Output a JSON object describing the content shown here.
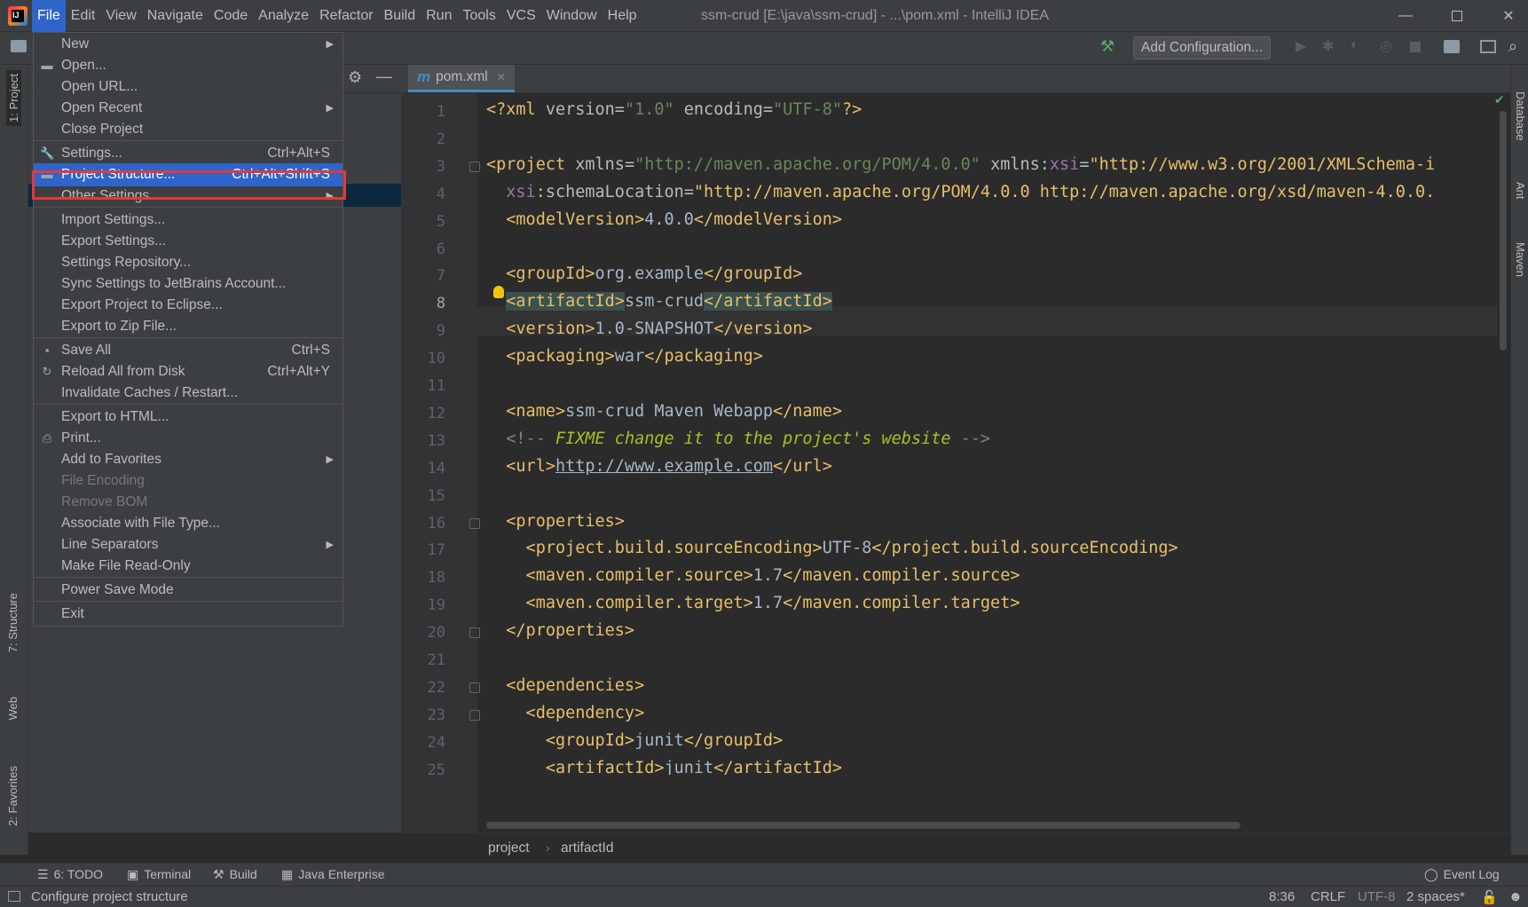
{
  "menubar": {
    "items": [
      "File",
      "Edit",
      "View",
      "Navigate",
      "Code",
      "Analyze",
      "Refactor",
      "Build",
      "Run",
      "Tools",
      "VCS",
      "Window",
      "Help"
    ],
    "window_title": "ssm-crud [E:\\java\\ssm-crud] - ...\\pom.xml - IntelliJ IDEA"
  },
  "toolbar": {
    "add_configuration": "Add Configuration..."
  },
  "editor_tab": {
    "label": "pom.xml"
  },
  "left_strip": {
    "project": "1: Project",
    "structure": "7: Structure",
    "web": "Web",
    "favorites": "2: Favorites"
  },
  "right_strip": {
    "database": "Database",
    "ant": "Ant",
    "maven": "Maven"
  },
  "file_menu": {
    "items": [
      {
        "label": "New",
        "shortcut": "",
        "submenu": true,
        "disabled": false
      },
      {
        "label": "Open...",
        "shortcut": "",
        "submenu": false,
        "disabled": false,
        "icon": "folder-icon"
      },
      {
        "label": "Open URL...",
        "shortcut": "",
        "submenu": false,
        "disabled": false
      },
      {
        "label": "Open Recent",
        "shortcut": "",
        "submenu": true,
        "disabled": false
      },
      {
        "label": "Close Project",
        "shortcut": "",
        "submenu": false,
        "disabled": false
      },
      {
        "label": "Settings...",
        "shortcut": "Ctrl+Alt+S",
        "submenu": false,
        "disabled": false,
        "icon": "wrench-icon"
      },
      {
        "label": "Project Structure...",
        "shortcut": "Ctrl+Alt+Shift+S",
        "submenu": false,
        "disabled": false,
        "selected": true,
        "icon": "project-structure-icon"
      },
      {
        "label": "Other Settings",
        "shortcut": "",
        "submenu": true,
        "disabled": false
      },
      {
        "label": "Import Settings...",
        "shortcut": "",
        "submenu": false,
        "disabled": false
      },
      {
        "label": "Export Settings...",
        "shortcut": "",
        "submenu": false,
        "disabled": false
      },
      {
        "label": "Settings Repository...",
        "shortcut": "",
        "submenu": false,
        "disabled": false
      },
      {
        "label": "Sync Settings to JetBrains Account...",
        "shortcut": "",
        "submenu": false,
        "disabled": false
      },
      {
        "label": "Export Project to Eclipse...",
        "shortcut": "",
        "submenu": false,
        "disabled": false
      },
      {
        "label": "Export to Zip File...",
        "shortcut": "",
        "submenu": false,
        "disabled": false
      },
      {
        "label": "Save All",
        "shortcut": "Ctrl+S",
        "submenu": false,
        "disabled": false,
        "icon": "save-icon"
      },
      {
        "label": "Reload All from Disk",
        "shortcut": "Ctrl+Alt+Y",
        "submenu": false,
        "disabled": false,
        "icon": "reload-icon"
      },
      {
        "label": "Invalidate Caches / Restart...",
        "shortcut": "",
        "submenu": false,
        "disabled": false
      },
      {
        "label": "Export to HTML...",
        "shortcut": "",
        "submenu": false,
        "disabled": false
      },
      {
        "label": "Print...",
        "shortcut": "",
        "submenu": false,
        "disabled": false,
        "icon": "print-icon"
      },
      {
        "label": "Add to Favorites",
        "shortcut": "",
        "submenu": true,
        "disabled": false
      },
      {
        "label": "File Encoding",
        "shortcut": "",
        "submenu": false,
        "disabled": true
      },
      {
        "label": "Remove BOM",
        "shortcut": "",
        "submenu": false,
        "disabled": true
      },
      {
        "label": "Associate with File Type...",
        "shortcut": "",
        "submenu": false,
        "disabled": false
      },
      {
        "label": "Line Separators",
        "shortcut": "",
        "submenu": true,
        "disabled": false
      },
      {
        "label": "Make File Read-Only",
        "shortcut": "",
        "submenu": false,
        "disabled": false
      },
      {
        "label": "Power Save Mode",
        "shortcut": "",
        "submenu": false,
        "disabled": false
      },
      {
        "label": "Exit",
        "shortcut": "",
        "submenu": false,
        "disabled": false
      }
    ]
  },
  "line_numbers": [
    "1",
    "2",
    "3",
    "4",
    "5",
    "6",
    "7",
    "8",
    "9",
    "10",
    "11",
    "12",
    "13",
    "14",
    "15",
    "16",
    "17",
    "18",
    "19",
    "20",
    "21",
    "22",
    "23",
    "24",
    "25"
  ],
  "code_lines": [
    "<?xml version=\"1.0\" encoding=\"UTF-8\"?>",
    "",
    "<project xmlns=\"http://maven.apache.org/POM/4.0.0\" xmlns:xsi=\"http://www.w3.org/2001/XMLSchema-i",
    "  xsi:schemaLocation=\"http://maven.apache.org/POM/4.0.0 http://maven.apache.org/xsd/maven-4.0.0.",
    "  <modelVersion>4.0.0</modelVersion>",
    "",
    "  <groupId>org.example</groupId>",
    "  <artifactId>ssm-crud</artifactId>",
    "  <version>1.0-SNAPSHOT</version>",
    "  <packaging>war</packaging>",
    "",
    "  <name>ssm-crud Maven Webapp</name>",
    "  <!-- FIXME change it to the project's website -->",
    "  <url>http://www.example.com</url>",
    "",
    "  <properties>",
    "    <project.build.sourceEncoding>UTF-8</project.build.sourceEncoding>",
    "    <maven.compiler.source>1.7</maven.compiler.source>",
    "    <maven.compiler.target>1.7</maven.compiler.target>",
    "  </properties>",
    "",
    "  <dependencies>",
    "    <dependency>",
    "      <groupId>junit</groupId>",
    "      <artifactId>junit</artifactId>"
  ],
  "breadcrumb": {
    "items": [
      "project",
      "artifactId"
    ]
  },
  "bottom_tabs": {
    "todo": "6: TODO",
    "terminal": "Terminal",
    "build": "Build",
    "java_enterprise": "Java Enterprise",
    "event_log": "Event Log"
  },
  "status": {
    "message": "Configure project structure",
    "position": "8:36",
    "line_sep": "CRLF",
    "encoding": "UTF-8",
    "indent": "2 spaces*"
  }
}
